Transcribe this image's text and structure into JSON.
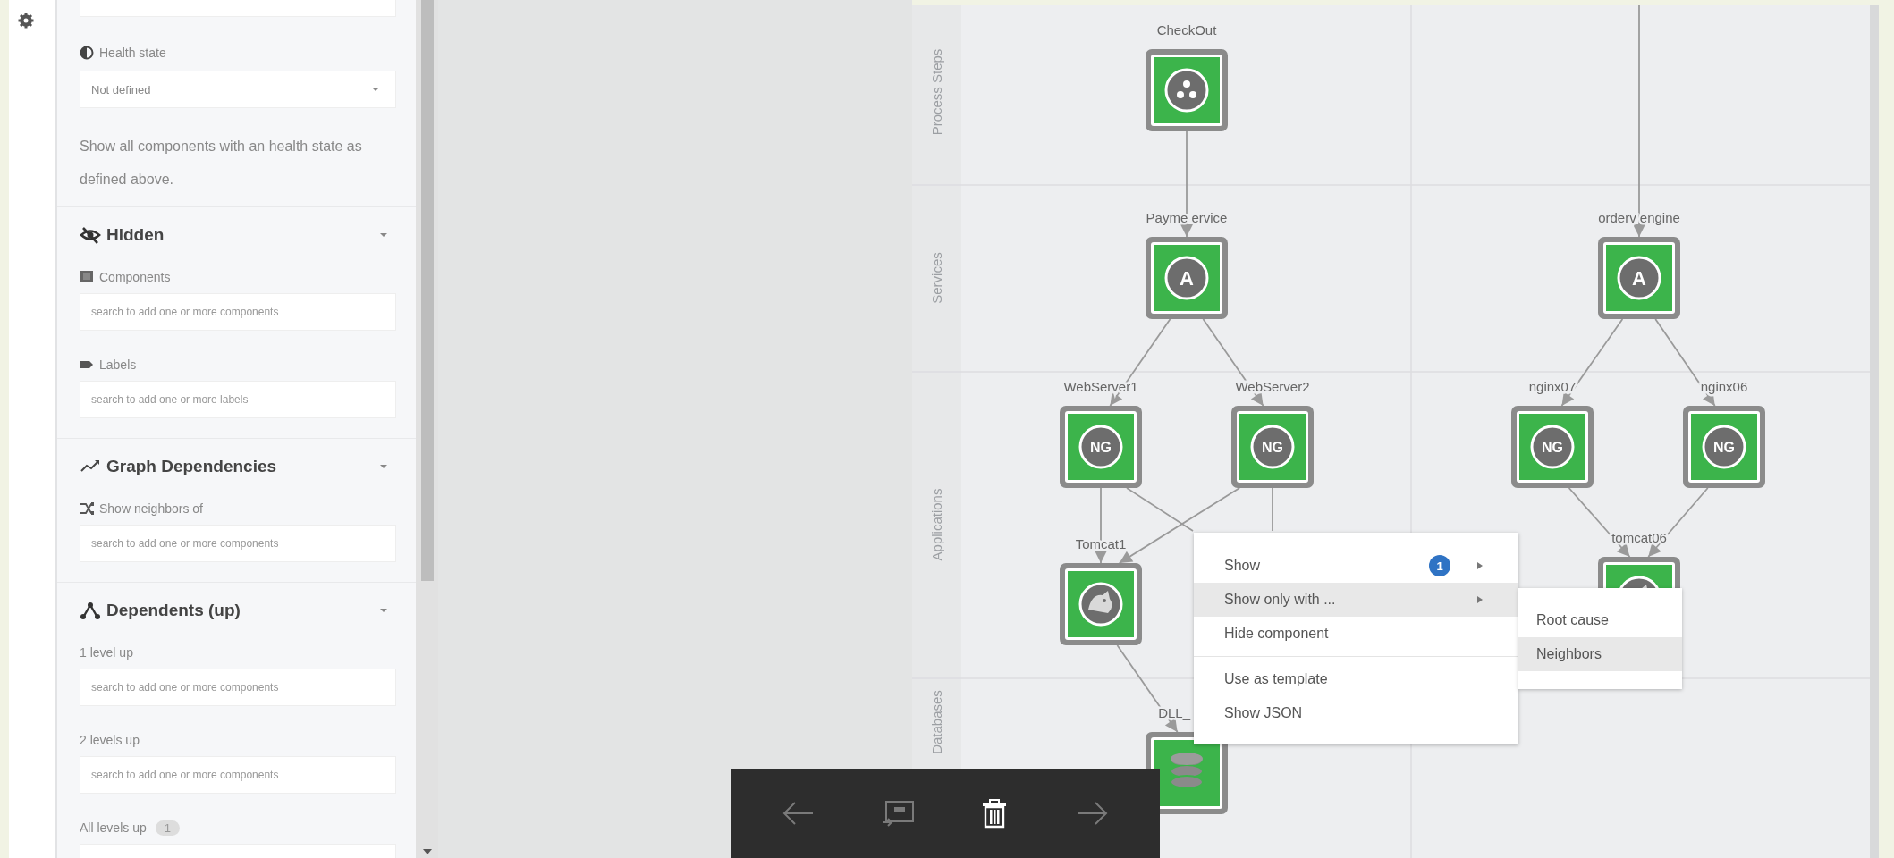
{
  "sidebar": {
    "health": {
      "label": "Health state",
      "value": "Not defined",
      "note": "Show all components with an health state as defined above."
    },
    "sections": [
      {
        "kind": "hidden",
        "title": "Hidden",
        "fields": [
          {
            "kind": "components",
            "label": "Components",
            "placeholder": "search to add one or more components"
          },
          {
            "kind": "labels",
            "label": "Labels",
            "placeholder": "search to add one or more labels"
          }
        ]
      },
      {
        "kind": "graph",
        "title": "Graph Dependencies",
        "fields": [
          {
            "kind": "neighbors",
            "label": "Show neighbors of",
            "placeholder": "search to add one or more components"
          }
        ]
      },
      {
        "kind": "dependents",
        "title": "Dependents (up)",
        "fields": [
          {
            "kind": "plain",
            "label": "1 level up",
            "placeholder": "search to add one or more components"
          },
          {
            "kind": "plain",
            "label": "2 levels up",
            "placeholder": "search to add one or more components"
          },
          {
            "kind": "plain",
            "label": "All levels up",
            "count": "1"
          }
        ]
      }
    ]
  },
  "graph": {
    "lanes": [
      "Process Steps",
      "Services",
      "Applications",
      "Databases"
    ],
    "nodes": [
      {
        "label": "CheckOut",
        "kind": "process"
      },
      {
        "label": "Payme ervice",
        "kind": "service",
        "badge": "A"
      },
      {
        "label": "orderv engine",
        "kind": "service",
        "badge": "A"
      },
      {
        "label": "WebServer1",
        "kind": "app",
        "badge": "NG"
      },
      {
        "label": "WebServer2",
        "kind": "app",
        "badge": "NG"
      },
      {
        "label": "nginx07",
        "kind": "app",
        "badge": "NG"
      },
      {
        "label": "nginx06",
        "kind": "app",
        "badge": "NG"
      },
      {
        "label": "Tomcat1",
        "kind": "tomcat"
      },
      {
        "label": "tomcat06",
        "kind": "tomcat"
      },
      {
        "label": "DLL_",
        "kind": "db"
      }
    ]
  },
  "context_menu": {
    "groups": [
      [
        {
          "label": "Show",
          "count": "1",
          "submenu": true,
          "selected": false
        },
        {
          "label": "Show only with ...",
          "submenu": true,
          "selected": true
        },
        {
          "label": "Hide component",
          "submenu": false,
          "selected": false
        }
      ],
      [
        {
          "label": "Use as template",
          "submenu": false,
          "selected": false
        },
        {
          "label": "Show JSON",
          "submenu": false,
          "selected": false
        }
      ]
    ],
    "submenu": [
      {
        "label": "Root cause",
        "selected": false
      },
      {
        "label": "Neighbors",
        "selected": true
      }
    ]
  },
  "toolbar": [
    {
      "kind": "back",
      "disabled": true
    },
    {
      "kind": "present",
      "disabled": true
    },
    {
      "kind": "delete",
      "disabled": false
    },
    {
      "kind": "forward",
      "disabled": true
    }
  ]
}
